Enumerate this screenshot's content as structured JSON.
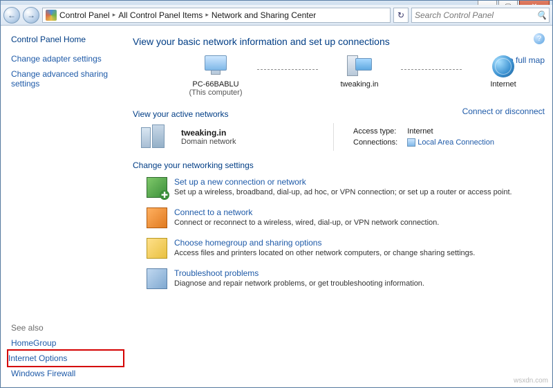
{
  "window": {
    "minimize": "—",
    "maximize": "▢",
    "close": "✕"
  },
  "nav": {
    "back": "←",
    "forward": "→",
    "crumb1": "Control Panel",
    "crumb2": "All Control Panel Items",
    "crumb3": "Network and Sharing Center",
    "sep": "▸",
    "refresh": "↻",
    "search_placeholder": "Search Control Panel"
  },
  "sidebar": {
    "home": "Control Panel Home",
    "adapter": "Change adapter settings",
    "advanced": "Change advanced sharing settings",
    "seealso": "See also",
    "homegroup": "HomeGroup",
    "inetopts": "Internet Options",
    "firewall": "Windows Firewall"
  },
  "main": {
    "help": "?",
    "title": "View your basic network information and set up connections",
    "seefull": "See full map",
    "node1_label": "PC-66BABLU",
    "node1_sub": "(This computer)",
    "node2_label": "tweaking.in",
    "node3_label": "Internet",
    "view_active": "View your active networks",
    "connect_disconnect": "Connect or disconnect",
    "net_name": "tweaking.in",
    "net_type": "Domain network",
    "access_k": "Access type:",
    "access_v": "Internet",
    "conn_k": "Connections:",
    "conn_v": "Local Area Connection",
    "change_settings": "Change your networking settings",
    "task1_title": "Set up a new connection or network",
    "task1_desc": "Set up a wireless, broadband, dial-up, ad hoc, or VPN connection; or set up a router or access point.",
    "task2_title": "Connect to a network",
    "task2_desc": "Connect or reconnect to a wireless, wired, dial-up, or VPN network connection.",
    "task3_title": "Choose homegroup and sharing options",
    "task3_desc": "Access files and printers located on other network computers, or change sharing settings.",
    "task4_title": "Troubleshoot problems",
    "task4_desc": "Diagnose and repair network problems, or get troubleshooting information."
  },
  "watermark": "wsxdn.com"
}
